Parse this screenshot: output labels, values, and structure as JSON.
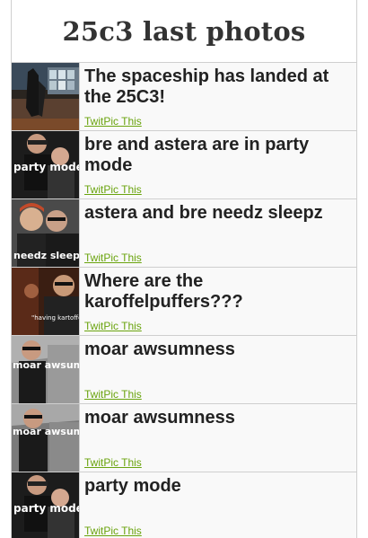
{
  "header": {
    "title": "25c3 last photos"
  },
  "photos": [
    {
      "title": "The spaceship has landed at the 25C3!",
      "link": "TwitPic This",
      "thumb_text": ""
    },
    {
      "title": "bre and astera are in party mode",
      "link": "TwitPic This",
      "thumb_text": "party mode"
    },
    {
      "title": "astera and bre needz sleepz",
      "link": "TwitPic This",
      "thumb_text": "needz sleepz"
    },
    {
      "title": "Where are the karoffelpuffers???",
      "link": "TwitPic This",
      "thumb_text": "\"having kartoffelpuffer"
    },
    {
      "title": "moar awsumness",
      "link": "TwitPic This",
      "thumb_text": "moar awsumness"
    },
    {
      "title": "moar awsumness",
      "link": "TwitPic This",
      "thumb_text": "moar awsumne"
    },
    {
      "title": "party mode",
      "link": "TwitPic This",
      "thumb_text": "party mode"
    }
  ],
  "colors": {
    "link": "#6aa40e",
    "title": "#222222",
    "row_bg": "#f9f9f9",
    "border": "#cfcfcf"
  }
}
